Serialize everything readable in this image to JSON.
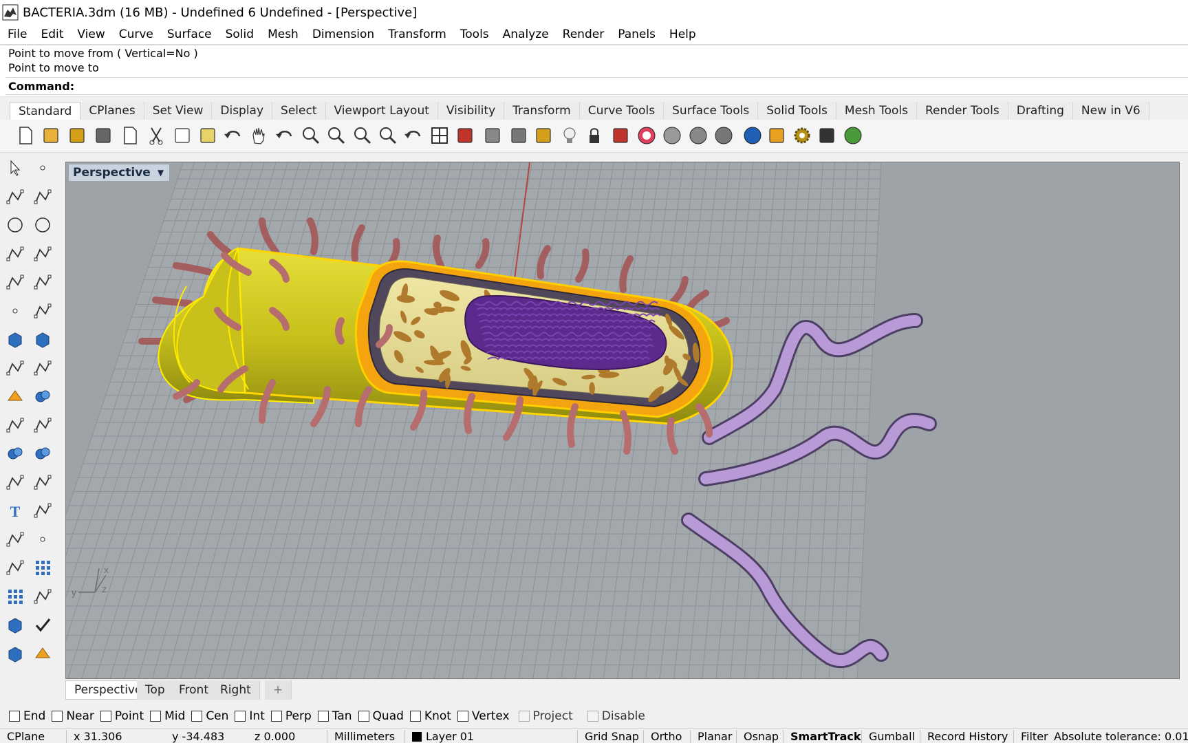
{
  "window": {
    "title": "BACTERIA.3dm (16 MB) - Undefined 6 Undefined - [Perspective]"
  },
  "menu": [
    "File",
    "Edit",
    "View",
    "Curve",
    "Surface",
    "Solid",
    "Mesh",
    "Dimension",
    "Transform",
    "Tools",
    "Analyze",
    "Render",
    "Panels",
    "Help"
  ],
  "command": {
    "history": [
      "Point to move from ( Vertical=No )",
      "Point to move to"
    ],
    "prompt": "Command:"
  },
  "toolbar_tabs": [
    "Standard",
    "CPlanes",
    "Set View",
    "Display",
    "Select",
    "Viewport Layout",
    "Visibility",
    "Transform",
    "Curve Tools",
    "Surface Tools",
    "Solid Tools",
    "Mesh Tools",
    "Render Tools",
    "Drafting",
    "New in V6"
  ],
  "active_toolbar_tab": "Standard",
  "standard_toolbar_icons": [
    "new-file-icon",
    "open-folder-icon",
    "save-icon",
    "print-icon",
    "import-icon",
    "cut-icon",
    "copy-icon",
    "paste-icon",
    "undo-icon",
    "pan-hand-icon",
    "rotate-view-icon",
    "zoom-dynamic-icon",
    "zoom-window-icon",
    "zoom-extents-icon",
    "zoom-selected-icon",
    "rotate-camera-icon",
    "four-viewports-icon",
    "car-icon",
    "cplane-icon",
    "osnap-target-icon",
    "select-points-icon",
    "light-bulb-icon",
    "lock-icon",
    "layer-icon",
    "color-wheel-icon",
    "wireframe-sphere-icon",
    "shaded-sphere-icon",
    "rendered-sphere-icon",
    "render-sphere-icon",
    "lasso-icon",
    "options-gear-icon",
    "dimension-icon",
    "globe-icon",
    "help-icon"
  ],
  "viewport": {
    "name": "Perspective",
    "axes": {
      "x": "x",
      "y": "y",
      "z": "z"
    }
  },
  "viewport_tabs": [
    "Perspective",
    "Top",
    "Front",
    "Right"
  ],
  "viewport_tab_add": "+",
  "osnaps": [
    {
      "label": "End",
      "checked": false
    },
    {
      "label": "Near",
      "checked": false
    },
    {
      "label": "Point",
      "checked": false
    },
    {
      "label": "Mid",
      "checked": false
    },
    {
      "label": "Cen",
      "checked": false
    },
    {
      "label": "Int",
      "checked": false
    },
    {
      "label": "Perp",
      "checked": false
    },
    {
      "label": "Tan",
      "checked": false
    },
    {
      "label": "Quad",
      "checked": false
    },
    {
      "label": "Knot",
      "checked": false
    },
    {
      "label": "Vertex",
      "checked": false
    },
    {
      "label": "Project",
      "checked": false,
      "disabled": true
    },
    {
      "label": "Disable",
      "checked": false,
      "disabled": true
    }
  ],
  "status": {
    "cplane": "CPlane",
    "x": "x 31.306",
    "y": "y -34.483",
    "z": "z 0.000",
    "units": "Millimeters",
    "layer": "Layer 01",
    "grid_snap": "Grid Snap",
    "ortho": "Ortho",
    "planar": "Planar",
    "osnap": "Osnap",
    "smarttrack": "SmartTrack",
    "gumball": "Gumball",
    "record_history": "Record History",
    "filter": "Filter",
    "tolerance": "Absolute tolerance: 0.01"
  },
  "colors": {
    "viewport_bg": "#9ea3a8",
    "grid": "#8d9297",
    "selected_outline": "#ffd400",
    "capsule_yellow": "#c9c21e",
    "pili_red": "#b56d6d",
    "flagella_purple": "#a98cc7",
    "nucleoid_purple": "#5b2a8c",
    "ribosome_brown": "#b07a2c"
  }
}
